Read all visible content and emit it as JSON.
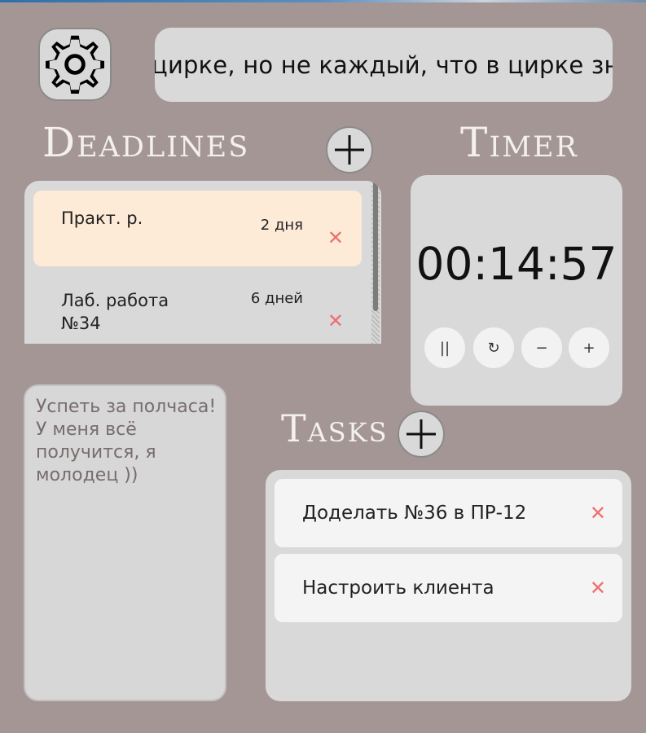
{
  "colors": {
    "background": "#a59696",
    "panel": "#d9d9d9",
    "highlight": "#fdebd7",
    "delete": "#ee6e6e",
    "heading": "#f4f0ee"
  },
  "header": {
    "settings_icon": "gear-icon",
    "marquee_text": "цирке, но не каждый, что в цирке зн"
  },
  "deadlines": {
    "title": "Deadlines",
    "add_icon": "plus-icon",
    "items": [
      {
        "name": "Практ. р.",
        "days": "2 дня",
        "delete": "✕",
        "highlighted": true
      },
      {
        "name": "Лаб. работа №34",
        "days": "6 дней",
        "delete": "✕",
        "highlighted": false
      }
    ]
  },
  "timer": {
    "title": "Timer",
    "display": "00:14:57",
    "buttons": {
      "pause": "||",
      "reset": "↻",
      "minus": "−",
      "plus": "+"
    }
  },
  "notes": {
    "text": "Успеть за полчаса!\nУ меня всё получится, я молодец ))"
  },
  "tasks": {
    "title": "Tasks",
    "add_icon": "plus-icon",
    "items": [
      {
        "text": "Доделать №36 в ПР-12",
        "delete": "✕"
      },
      {
        "text": "Настроить клиента",
        "delete": "✕"
      }
    ]
  }
}
